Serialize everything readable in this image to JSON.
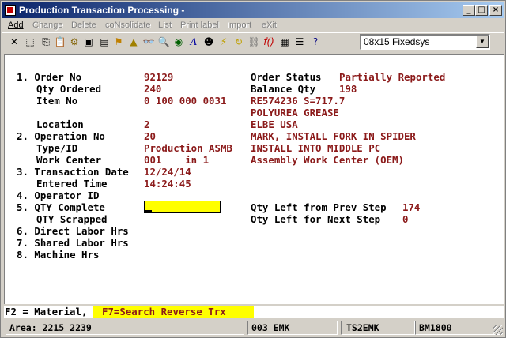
{
  "window": {
    "title": "Production Transaction Processing -"
  },
  "menu": [
    {
      "label": "Add",
      "enabled": true
    },
    {
      "label": "Change",
      "enabled": false
    },
    {
      "label": "Delete",
      "enabled": false
    },
    {
      "label": "coNsolidate",
      "enabled": false
    },
    {
      "label": "List",
      "enabled": false
    },
    {
      "label": "Print label",
      "enabled": false
    },
    {
      "label": "Import",
      "enabled": false
    },
    {
      "label": "eXit",
      "enabled": false
    }
  ],
  "toolbar": {
    "icons": [
      "close-x-icon",
      "select-icon",
      "copy-icon",
      "paste-icon",
      "settings-gear-icon",
      "window-icon",
      "document-icon",
      "flag-icon",
      "bell-icon",
      "find-icon",
      "zoom-icon",
      "globe-icon",
      "font-icon",
      "user-icon",
      "lightning-icon",
      "refresh-icon",
      "link-icon",
      "function-icon",
      "calculator-icon",
      "list-icon",
      "help-icon"
    ],
    "font_select": "08x15 Fixedsys"
  },
  "form": {
    "order_no": {
      "label": "1. Order No",
      "value": "92129"
    },
    "qty_ordered": {
      "label": "Qty Ordered",
      "value": "240"
    },
    "item_no": {
      "label": "Item No",
      "value": "0 100 000 0031"
    },
    "location": {
      "label": "Location",
      "value": "2"
    },
    "operation_no": {
      "label": "2. Operation No",
      "value": "20"
    },
    "type_id": {
      "label": "Type/ID",
      "value": "Production ASMB"
    },
    "work_center": {
      "label": "Work Center",
      "value": "001    in 1"
    },
    "transaction_date": {
      "label": "3. Transaction Date",
      "value": "12/24/14"
    },
    "entered_time": {
      "label": "Entered Time",
      "value": "14:24:45"
    },
    "operator_id": {
      "label": "4. Operator ID",
      "value": ""
    },
    "qty_complete": {
      "label": "5. QTY Complete",
      "value": ""
    },
    "qty_scrapped": {
      "label": "QTY Scrapped",
      "value": ""
    },
    "direct_labor": {
      "label": "6. Direct Labor Hrs",
      "value": ""
    },
    "shared_labor": {
      "label": "7. Shared Labor Hrs",
      "value": ""
    },
    "machine_hrs": {
      "label": "8. Machine Hrs",
      "value": ""
    },
    "order_status": {
      "label": "Order Status",
      "value": "Partially Reported"
    },
    "balance_qty": {
      "label": "Balance Qty",
      "value": "198"
    },
    "item_desc1": "RE574236 S=717.7",
    "item_desc2": "POLYUREA GREASE",
    "location_desc": "ELBE USA",
    "operation_desc": "MARK, INSTALL FORK IN SPIDER",
    "type_desc": "INSTALL INTO MIDDLE PC",
    "work_center_desc": "Assembly Work Center (OEM)",
    "qty_left_prev": {
      "label": "Qty Left from Prev Step",
      "value": "174"
    },
    "qty_left_next": {
      "label": "Qty Left for Next Step",
      "value": "0"
    }
  },
  "fkeys": {
    "f2": "F2 = Material,",
    "f7": "F7=Search Reverse Trx"
  },
  "status": {
    "area": "Area: 2215 2239",
    "code": "003 EMK",
    "company": "TS2EMK",
    "terminal": "BM1800"
  }
}
